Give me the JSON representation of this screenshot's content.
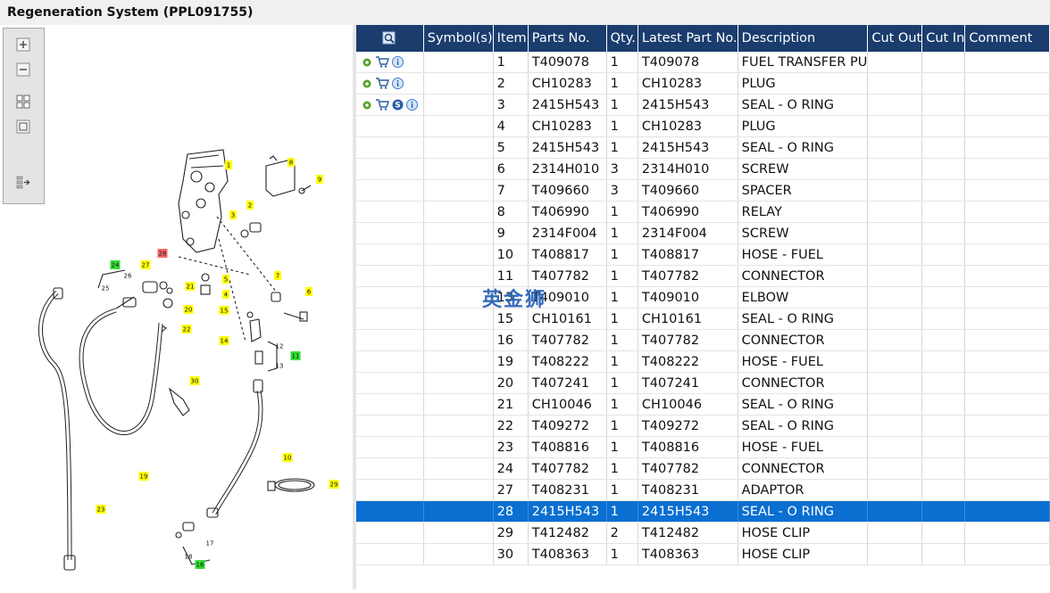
{
  "window": {
    "title": "Regeneration System (PPL091755)"
  },
  "toolbox": {
    "buttons": [
      "zoom-in",
      "zoom-out",
      "fit-page",
      "actual-size",
      "sync-table"
    ]
  },
  "colors": {
    "header_bg": "#1a3d6e",
    "selected_row": "#0a6fd1",
    "callout_yellow": "#ffff00",
    "callout_green": "#33dd33",
    "callout_red": "#ff6666"
  },
  "table": {
    "columns": [
      "",
      "Symbol(s)",
      "Item",
      "Parts No.",
      "Qty.",
      "Latest Part No.",
      "Description",
      "Cut Out",
      "Cut In",
      "Comment"
    ],
    "rows": [
      {
        "item": "1",
        "part": "T409078",
        "qty": "1",
        "latest": "T409078",
        "desc": "FUEL TRANSFER PU",
        "icons": [
          "gear",
          "cart",
          "info"
        ],
        "selected": false
      },
      {
        "item": "2",
        "part": "CH10283",
        "qty": "1",
        "latest": "CH10283",
        "desc": "PLUG",
        "icons": [
          "gear",
          "cart",
          "info"
        ],
        "selected": false
      },
      {
        "item": "3",
        "part": "2415H543",
        "qty": "1",
        "latest": "2415H543",
        "desc": "SEAL - O RING",
        "icons": [
          "gear",
          "cart",
          "s",
          "info"
        ],
        "selected": false
      },
      {
        "item": "4",
        "part": "CH10283",
        "qty": "1",
        "latest": "CH10283",
        "desc": "PLUG",
        "icons": [],
        "selected": false
      },
      {
        "item": "5",
        "part": "2415H543",
        "qty": "1",
        "latest": "2415H543",
        "desc": "SEAL - O RING",
        "icons": [],
        "selected": false
      },
      {
        "item": "6",
        "part": "2314H010",
        "qty": "3",
        "latest": "2314H010",
        "desc": "SCREW",
        "icons": [],
        "selected": false
      },
      {
        "item": "7",
        "part": "T409660",
        "qty": "3",
        "latest": "T409660",
        "desc": "SPACER",
        "icons": [],
        "selected": false
      },
      {
        "item": "8",
        "part": "T406990",
        "qty": "1",
        "latest": "T406990",
        "desc": "RELAY",
        "icons": [],
        "selected": false
      },
      {
        "item": "9",
        "part": "2314F004",
        "qty": "1",
        "latest": "2314F004",
        "desc": "SCREW",
        "icons": [],
        "selected": false
      },
      {
        "item": "10",
        "part": "T408817",
        "qty": "1",
        "latest": "T408817",
        "desc": "HOSE - FUEL",
        "icons": [],
        "selected": false
      },
      {
        "item": "11",
        "part": "T407782",
        "qty": "1",
        "latest": "T407782",
        "desc": "CONNECTOR",
        "icons": [],
        "selected": false
      },
      {
        "item": "13",
        "part": "T409010",
        "qty": "1",
        "latest": "T409010",
        "desc": "ELBOW",
        "icons": [],
        "selected": false
      },
      {
        "item": "15",
        "part": "CH10161",
        "qty": "1",
        "latest": "CH10161",
        "desc": "SEAL - O RING",
        "icons": [],
        "selected": false
      },
      {
        "item": "16",
        "part": "T407782",
        "qty": "1",
        "latest": "T407782",
        "desc": "CONNECTOR",
        "icons": [],
        "selected": false
      },
      {
        "item": "19",
        "part": "T408222",
        "qty": "1",
        "latest": "T408222",
        "desc": "HOSE - FUEL",
        "icons": [],
        "selected": false
      },
      {
        "item": "20",
        "part": "T407241",
        "qty": "1",
        "latest": "T407241",
        "desc": "CONNECTOR",
        "icons": [],
        "selected": false
      },
      {
        "item": "21",
        "part": "CH10046",
        "qty": "1",
        "latest": "CH10046",
        "desc": "SEAL - O RING",
        "icons": [],
        "selected": false
      },
      {
        "item": "22",
        "part": "T409272",
        "qty": "1",
        "latest": "T409272",
        "desc": "SEAL - O RING",
        "icons": [],
        "selected": false
      },
      {
        "item": "23",
        "part": "T408816",
        "qty": "1",
        "latest": "T408816",
        "desc": "HOSE - FUEL",
        "icons": [],
        "selected": false
      },
      {
        "item": "24",
        "part": "T407782",
        "qty": "1",
        "latest": "T407782",
        "desc": "CONNECTOR",
        "icons": [],
        "selected": false
      },
      {
        "item": "27",
        "part": "T408231",
        "qty": "1",
        "latest": "T408231",
        "desc": "ADAPTOR",
        "icons": [],
        "selected": false
      },
      {
        "item": "28",
        "part": "2415H543",
        "qty": "1",
        "latest": "2415H543",
        "desc": "SEAL - O RING",
        "icons": [],
        "selected": true
      },
      {
        "item": "29",
        "part": "T412482",
        "qty": "2",
        "latest": "T412482",
        "desc": "HOSE CLIP",
        "icons": [],
        "selected": false
      },
      {
        "item": "30",
        "part": "T408363",
        "qty": "1",
        "latest": "T408363",
        "desc": "HOSE CLIP",
        "icons": [],
        "selected": false
      }
    ]
  },
  "watermark": "英金狮",
  "diagram": {
    "callouts": [
      {
        "label": "1",
        "color": "yellow"
      },
      {
        "label": "2",
        "color": "yellow"
      },
      {
        "label": "3",
        "color": "yellow"
      },
      {
        "label": "4",
        "color": "yellow"
      },
      {
        "label": "5",
        "color": "yellow"
      },
      {
        "label": "6",
        "color": "yellow"
      },
      {
        "label": "7",
        "color": "yellow"
      },
      {
        "label": "8",
        "color": "yellow"
      },
      {
        "label": "9",
        "color": "yellow"
      },
      {
        "label": "10",
        "color": "yellow"
      },
      {
        "label": "11",
        "color": "green"
      },
      {
        "label": "12",
        "color": "none"
      },
      {
        "label": "13",
        "color": "none"
      },
      {
        "label": "14",
        "color": "yellow"
      },
      {
        "label": "15",
        "color": "yellow"
      },
      {
        "label": "16",
        "color": "green"
      },
      {
        "label": "17",
        "color": "none"
      },
      {
        "label": "18",
        "color": "none"
      },
      {
        "label": "19",
        "color": "yellow"
      },
      {
        "label": "20",
        "color": "yellow"
      },
      {
        "label": "21",
        "color": "yellow"
      },
      {
        "label": "22",
        "color": "yellow"
      },
      {
        "label": "23",
        "color": "yellow"
      },
      {
        "label": "24",
        "color": "green"
      },
      {
        "label": "25",
        "color": "none"
      },
      {
        "label": "26",
        "color": "none"
      },
      {
        "label": "27",
        "color": "yellow"
      },
      {
        "label": "28",
        "color": "red"
      },
      {
        "label": "29",
        "color": "yellow"
      },
      {
        "label": "30",
        "color": "yellow"
      }
    ]
  }
}
